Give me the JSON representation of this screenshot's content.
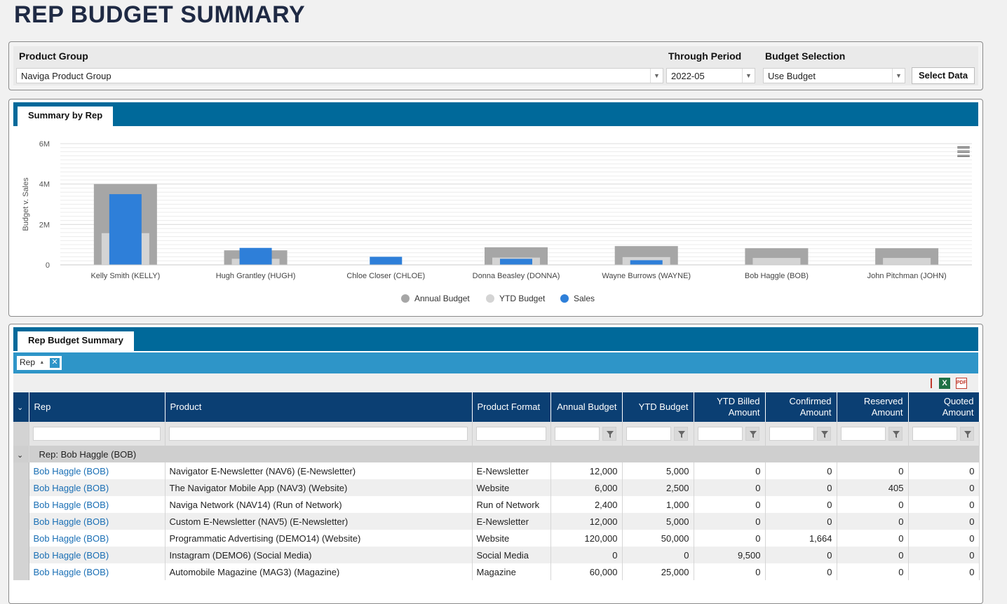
{
  "page": {
    "title": "REP BUDGET SUMMARY"
  },
  "filters": {
    "product_group": {
      "label": "Product Group",
      "value": "Naviga Product Group"
    },
    "through_period": {
      "label": "Through Period",
      "value": "2022-05"
    },
    "budget_selection": {
      "label": "Budget Selection",
      "value": "Use Budget"
    },
    "select_button": "Select Data"
  },
  "chart_panel": {
    "tab_label": "Summary by Rep"
  },
  "chart_data": {
    "type": "bar",
    "title": "",
    "ylabel": "Budget v. Sales",
    "xlabel": "",
    "ylim": [
      0,
      6000000
    ],
    "y_ticks": [
      "0",
      "2M",
      "4M",
      "6M"
    ],
    "categories": [
      "Kelly Smith (KELLY)",
      "Hugh Grantley (HUGH)",
      "Chloe Closer (CHLOE)",
      "Donna Beasley (DONNA)",
      "Wayne Burrows (WAYNE)",
      "Bob Haggle (BOB)",
      "John Pitchman (JOHN)"
    ],
    "series": [
      {
        "name": "Annual Budget",
        "color": "#a6a6a6",
        "values": [
          4000000,
          720000,
          0,
          870000,
          930000,
          825000,
          825000
        ]
      },
      {
        "name": "YTD Budget",
        "color": "#d4d4d4",
        "values": [
          1570000,
          300000,
          0,
          360000,
          385000,
          343000,
          343000
        ]
      },
      {
        "name": "Sales",
        "color": "#2e7fd9",
        "values": [
          3500000,
          840000,
          400000,
          300000,
          230000,
          0,
          0
        ]
      }
    ],
    "legend_position": "bottom-center",
    "grid": true
  },
  "grid_panel": {
    "tab_label": "Rep Budget Summary",
    "group_chip": "Rep",
    "columns": [
      "Rep",
      "Product",
      "Product Format",
      "Annual Budget",
      "YTD Budget",
      "YTD Billed Amount",
      "Confirmed Amount",
      "Reserved Amount",
      "Quoted Amount"
    ],
    "group_label": "Rep: Bob Haggle (BOB)",
    "rows": [
      [
        "Bob Haggle (BOB)",
        "Navigator E-Newsletter (NAV6) (E-Newsletter)",
        "E-Newsletter",
        "12,000",
        "5,000",
        "0",
        "0",
        "0",
        "0"
      ],
      [
        "Bob Haggle (BOB)",
        "The Navigator Mobile App (NAV3) (Website)",
        "Website",
        "6,000",
        "2,500",
        "0",
        "0",
        "405",
        "0"
      ],
      [
        "Bob Haggle (BOB)",
        "Naviga Network (NAV14) (Run of Network)",
        "Run of Network",
        "2,400",
        "1,000",
        "0",
        "0",
        "0",
        "0"
      ],
      [
        "Bob Haggle (BOB)",
        "Custom E-Newsletter (NAV5) (E-Newsletter)",
        "E-Newsletter",
        "12,000",
        "5,000",
        "0",
        "0",
        "0",
        "0"
      ],
      [
        "Bob Haggle (BOB)",
        "Programmatic Advertising (DEMO14) (Website)",
        "Website",
        "120,000",
        "50,000",
        "0",
        "1,664",
        "0",
        "0"
      ],
      [
        "Bob Haggle (BOB)",
        "Instagram (DEMO6) (Social Media)",
        "Social Media",
        "0",
        "0",
        "9,500",
        "0",
        "0",
        "0"
      ],
      [
        "Bob Haggle (BOB)",
        "Automobile Magazine (MAG3) (Magazine)",
        "Magazine",
        "60,000",
        "25,000",
        "0",
        "0",
        "0",
        "0"
      ]
    ]
  }
}
